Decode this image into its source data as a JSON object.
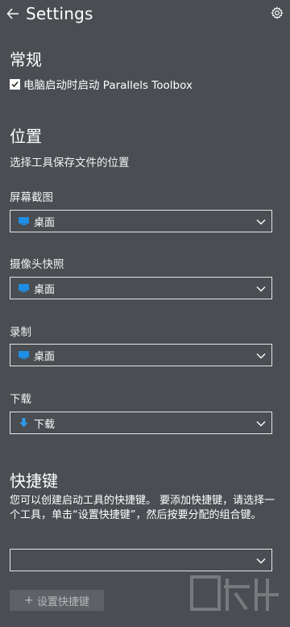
{
  "header": {
    "title": "Settings"
  },
  "general": {
    "heading": "常规",
    "startup_checkbox": {
      "label": "电脑启动时启动 Parallels Toolbox",
      "checked": true
    }
  },
  "location": {
    "heading": "位置",
    "description": "选择工具保存文件的位置",
    "items": [
      {
        "label": "屏幕截图",
        "value": "桌面",
        "icon": "desktop-icon"
      },
      {
        "label": "摄像头快照",
        "value": "桌面",
        "icon": "desktop-icon"
      },
      {
        "label": "录制",
        "value": "桌面",
        "icon": "desktop-icon"
      },
      {
        "label": "下载",
        "value": "下载",
        "icon": "download-icon"
      }
    ]
  },
  "shortcuts": {
    "heading": "快捷键",
    "description": "您可以创建启动工具的快捷键。 要添加快捷键，请选择一个工具，单击“设置快捷键”，然后按要分配的组合键。",
    "tool_select_value": "",
    "set_button_label": "设置快捷键"
  },
  "colors": {
    "background": "#4a4d52",
    "desktop_icon": "#1e8fe6",
    "download_icon": "#2d9cf0"
  }
}
